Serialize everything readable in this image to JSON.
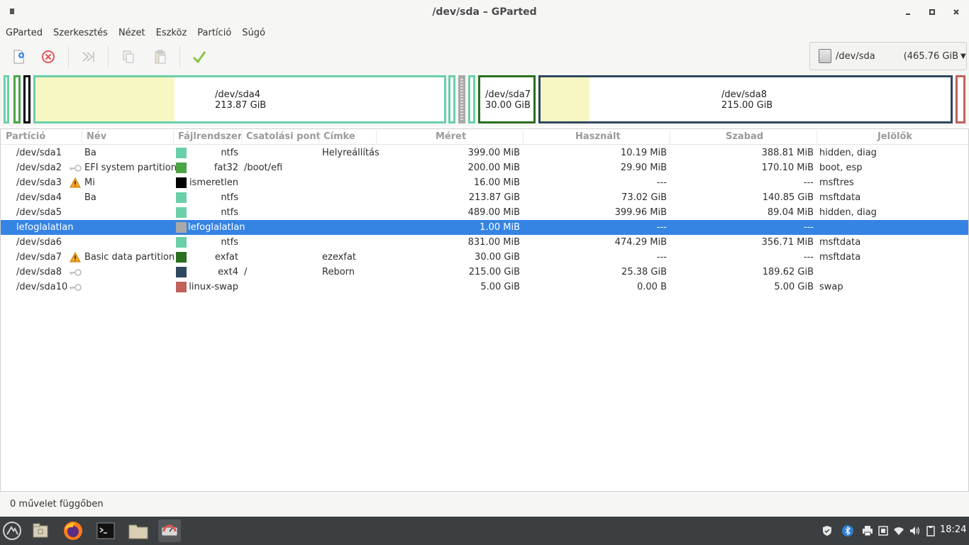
{
  "window": {
    "title": "/dev/sda – GParted"
  },
  "menubar": {
    "items": [
      "GParted",
      "Szerkesztés",
      "Nézet",
      "Eszköz",
      "Partíció",
      "Súgó"
    ]
  },
  "toolbar": {
    "buttons": [
      "new-icon",
      "delete-icon",
      "resize-move-icon",
      "copy-icon",
      "paste-icon",
      "apply-icon"
    ],
    "device": {
      "name": "/dev/sda",
      "size": "(465.76 GiB"
    }
  },
  "partition_map": {
    "sda4": {
      "name": "/dev/sda4",
      "size": "213.87 GiB",
      "used_fraction": 0.34
    },
    "sda7": {
      "name": "/dev/sda7",
      "size": "30.00 GiB"
    },
    "sda8": {
      "name": "/dev/sda8",
      "size": "215.00 GiB",
      "used_fraction": 0.12
    }
  },
  "table": {
    "headers": [
      "Partíció",
      "Név",
      "Fájlrendszer",
      "Csatolási pont",
      "Címke",
      "Méret",
      "Használt",
      "Szabad",
      "Jelölők"
    ],
    "rows": [
      {
        "partition": "/dev/sda1",
        "name": "Ba",
        "icon": "",
        "fs": "ntfs",
        "fs_color": "#6bcfa9",
        "mount": "",
        "label": "Helyreállítás",
        "size": "399.00 MiB",
        "used": "10.19 MiB",
        "free": "388.81 MiB",
        "flags": "hidden, diag"
      },
      {
        "partition": "/dev/sda2",
        "name": "EFI system partition",
        "icon": "key-icon",
        "fs": "fat32",
        "fs_color": "#4aa545",
        "mount": "/boot/efi",
        "label": "",
        "size": "200.00 MiB",
        "used": "29.90 MiB",
        "free": "170.10 MiB",
        "flags": "boot, esp"
      },
      {
        "partition": "/dev/sda3",
        "name": "Mi",
        "icon": "warning-icon",
        "fs": "ismeretlen",
        "fs_color": "#000000",
        "mount": "",
        "label": "",
        "size": "16.00 MiB",
        "used": "---",
        "free": "---",
        "flags": "msftres"
      },
      {
        "partition": "/dev/sda4",
        "name": "Ba",
        "icon": "",
        "fs": "ntfs",
        "fs_color": "#6bcfa9",
        "mount": "",
        "label": "",
        "size": "213.87 GiB",
        "used": "73.02 GiB",
        "free": "140.85 GiB",
        "flags": "msftdata"
      },
      {
        "partition": "/dev/sda5",
        "name": "",
        "icon": "",
        "fs": "ntfs",
        "fs_color": "#6bcfa9",
        "mount": "",
        "label": "",
        "size": "489.00 MiB",
        "used": "399.96 MiB",
        "free": "89.04 MiB",
        "flags": "hidden, diag"
      },
      {
        "partition": "lefoglalatlan",
        "name": "",
        "icon": "",
        "fs": "lefoglalatlan",
        "fs_color": "#a9a9a9",
        "mount": "",
        "label": "",
        "size": "1.00 MiB",
        "used": "---",
        "free": "---",
        "flags": ""
      },
      {
        "partition": "/dev/sda6",
        "name": "",
        "icon": "",
        "fs": "ntfs",
        "fs_color": "#6bcfa9",
        "mount": "",
        "label": "",
        "size": "831.00 MiB",
        "used": "474.29 MiB",
        "free": "356.71 MiB",
        "flags": "msftdata"
      },
      {
        "partition": "/dev/sda7",
        "name": "Basic data partition",
        "icon": "warning-icon",
        "fs": "exfat",
        "fs_color": "#2b6f20",
        "mount": "",
        "label": "ezexfat",
        "size": "30.00 GiB",
        "used": "---",
        "free": "---",
        "flags": "msftdata"
      },
      {
        "partition": "/dev/sda8",
        "name": "",
        "icon": "key-icon",
        "fs": "ext4",
        "fs_color": "#30485f",
        "mount": "/",
        "label": "Reborn",
        "size": "215.00 GiB",
        "used": "25.38 GiB",
        "free": "189.62 GiB",
        "flags": ""
      },
      {
        "partition": "/dev/sda10",
        "name": "",
        "icon": "key-icon",
        "fs": "linux-swap",
        "fs_color": "#c0625a",
        "mount": "",
        "label": "",
        "size": "5.00 GiB",
        "used": "0.00 B",
        "free": "5.00 GiB",
        "flags": "swap"
      }
    ]
  },
  "status": {
    "text": "0 művelet függőben"
  },
  "taskbar": {
    "apps": [
      "menu-icon",
      "file-manager-icon",
      "firefox-icon",
      "terminal-icon",
      "folder-icon",
      "gparted-icon"
    ],
    "tray": [
      "shield-icon",
      "bluetooth-icon",
      "printer-icon",
      "battery-icon",
      "wifi-icon",
      "volume-icon",
      "clipboard-icon"
    ],
    "clock": "18:24"
  }
}
